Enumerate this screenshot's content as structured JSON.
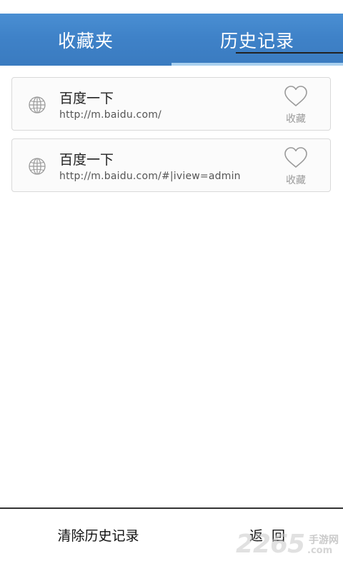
{
  "tabs": [
    {
      "label": "收藏夹",
      "active": false
    },
    {
      "label": "历史记录",
      "active": true
    }
  ],
  "history": [
    {
      "title": "百度一下",
      "url": "http://m.baidu.com/",
      "fav_label": "收藏",
      "icon": "globe-icon"
    },
    {
      "title": "百度一下",
      "url": "http://m.baidu.com/#|iview=admin",
      "fav_label": "收藏",
      "icon": "globe-icon"
    }
  ],
  "bottom": {
    "clear_label": "清除历史记录",
    "back_label": "返回"
  },
  "watermark": {
    "number": "2265",
    "site": "手游网",
    "domain_suffix": ".com"
  },
  "colors": {
    "tab_bar": "#3f82c8",
    "tab_indicator": "#a9d0ef",
    "card_border": "#d9d9d9"
  }
}
